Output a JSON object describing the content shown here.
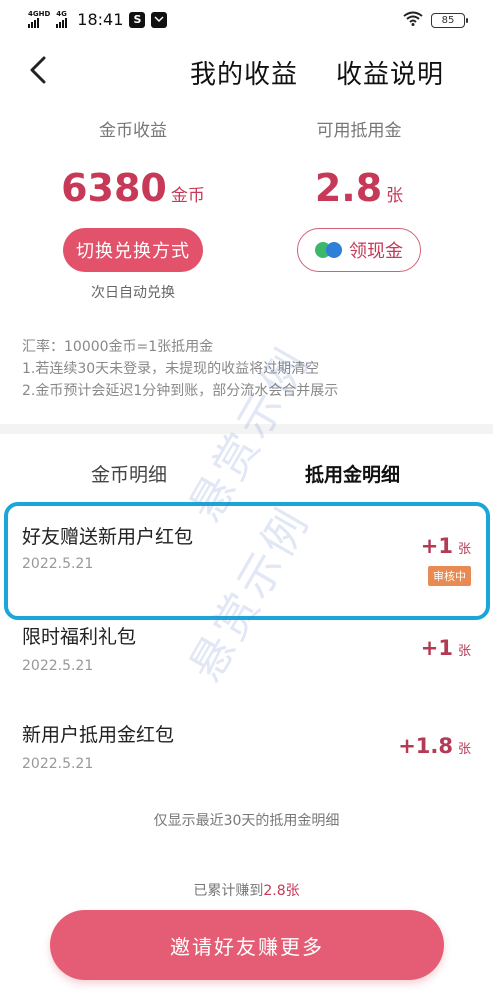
{
  "status_bar": {
    "net1": "4GHD",
    "net2": "4G",
    "time": "18:41",
    "battery": "85"
  },
  "header": {
    "title": "我的收益",
    "link": "收益说明"
  },
  "coins": {
    "label": "金币收益",
    "value": "6380",
    "unit": "金币",
    "button": "切换兑换方式",
    "note": "次日自动兑换"
  },
  "vouchers": {
    "label": "可用抵用金",
    "value": "2.8",
    "unit": "张",
    "button": "领现金"
  },
  "rules": {
    "rate": "汇率：10000金币=1张抵用金",
    "rule1": "1.若连续30天未登录，未提现的收益将过期清空",
    "rule2": "2.金币预计会延迟1分钟到账，部分流水会合并展示"
  },
  "tabs": {
    "coin_detail": "金币明细",
    "voucher_detail": "抵用金明细"
  },
  "items": [
    {
      "title": "好友赠送新用户红包",
      "date": "2022.5.21",
      "amount": "+1",
      "unit": "张",
      "badge": "审核中"
    },
    {
      "title": "限时福利礼包",
      "date": "2022.5.21",
      "amount": "+1",
      "unit": "张"
    },
    {
      "title": "新用户抵用金红包",
      "date": "2022.5.21",
      "amount": "+1.8",
      "unit": "张"
    }
  ],
  "footer": {
    "note": "仅显示最近30天的抵用金明细",
    "total_prefix": "已累计赚到",
    "total_value": "2.8张",
    "invite": "邀请好友赚更多"
  },
  "watermark": "悬赏示例",
  "colors": {
    "accent": "#e2536b",
    "value_text": "#c63a57",
    "highlight": "#1aa6d8",
    "badge": "#e88a52"
  }
}
